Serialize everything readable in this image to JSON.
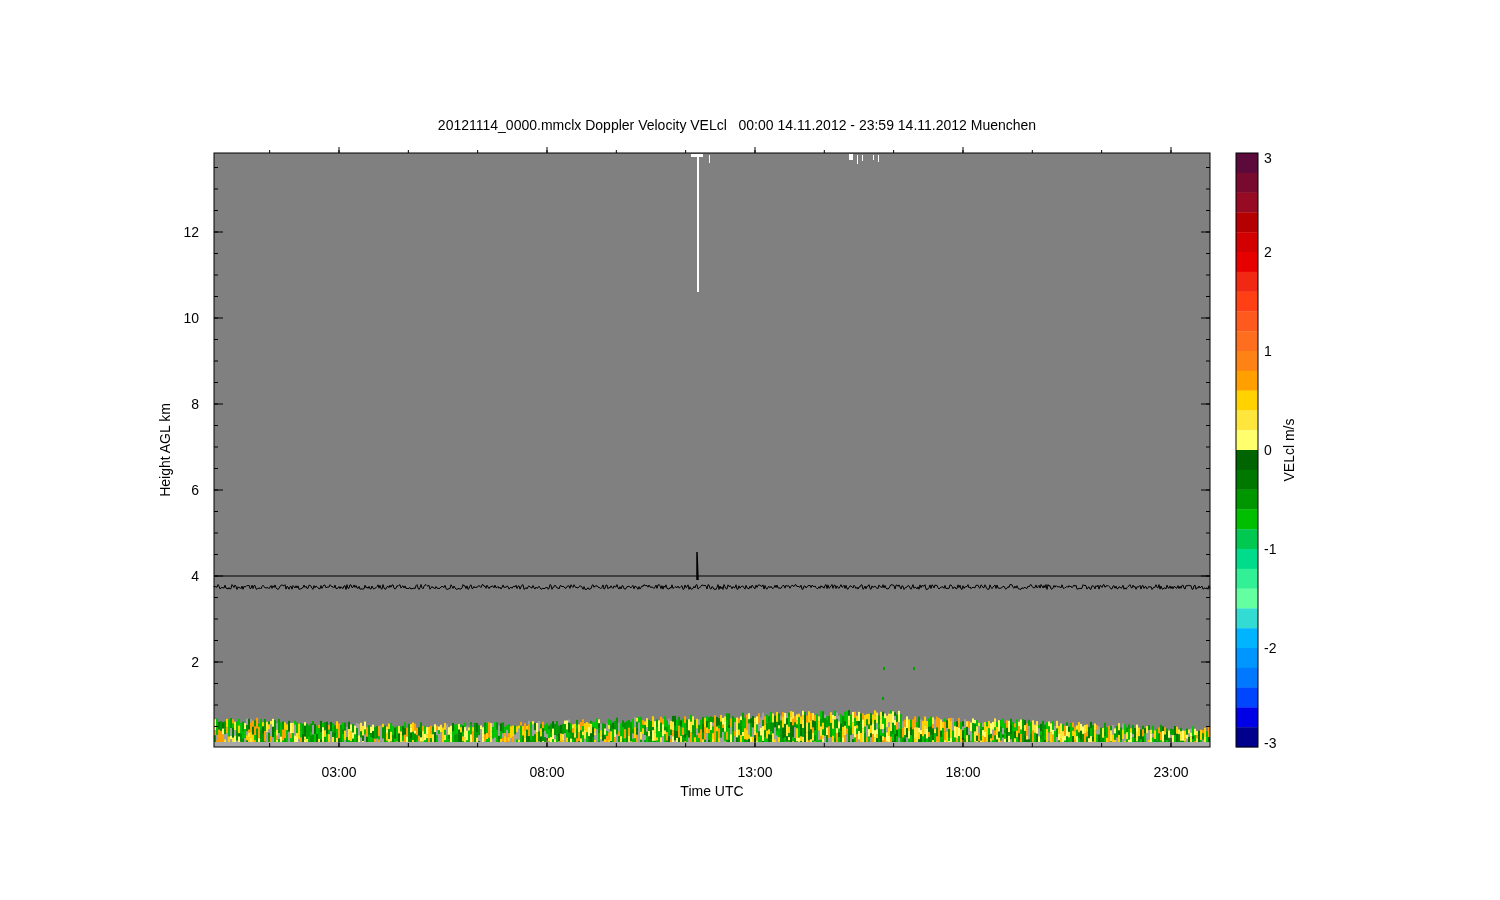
{
  "plot": {
    "title": "20121114_0000.mmclx Doppler Velocity VELcl   00:00 14.11.2012 - 23:59 14.11.2012 Muenchen",
    "y_axis": {
      "label": "Height AGL km",
      "ticks": [
        "12",
        "10",
        "8",
        "6",
        "4",
        "2"
      ]
    },
    "x_axis": {
      "label": "Time UTC",
      "ticks": [
        "03:00",
        "08:00",
        "13:00",
        "18:00",
        "23:00"
      ]
    }
  },
  "colorbar": {
    "label": "VELcl m/s",
    "ticks": [
      "3",
      "2",
      "1",
      "0",
      "-1",
      "-2",
      "-3"
    ],
    "colors": [
      {
        "color": "#5c0a3c"
      },
      {
        "color": "#780a30"
      },
      {
        "color": "#960a24"
      },
      {
        "color": "#b40000"
      },
      {
        "color": "#d20000"
      },
      {
        "color": "#e60000"
      },
      {
        "color": "#f02814"
      },
      {
        "color": "#ff4014"
      },
      {
        "color": "#ff5a1e"
      },
      {
        "color": "#ff6e1e"
      },
      {
        "color": "#ff8214"
      },
      {
        "color": "#ffa000"
      },
      {
        "color": "#ffd200"
      },
      {
        "color": "#ffe63c"
      },
      {
        "color": "#ffff6e"
      },
      {
        "color": "#006400"
      },
      {
        "color": "#007800"
      },
      {
        "color": "#009600"
      },
      {
        "color": "#00be00"
      },
      {
        "color": "#00c850"
      },
      {
        "color": "#00dc8c"
      },
      {
        "color": "#32f096"
      },
      {
        "color": "#64ffa0"
      },
      {
        "color": "#32dcd2"
      },
      {
        "color": "#00b4ff"
      },
      {
        "color": "#0096ff"
      },
      {
        "color": "#0078ff"
      },
      {
        "color": "#0046ff"
      },
      {
        "color": "#0000e6"
      },
      {
        "color": "#00008c"
      }
    ]
  }
}
